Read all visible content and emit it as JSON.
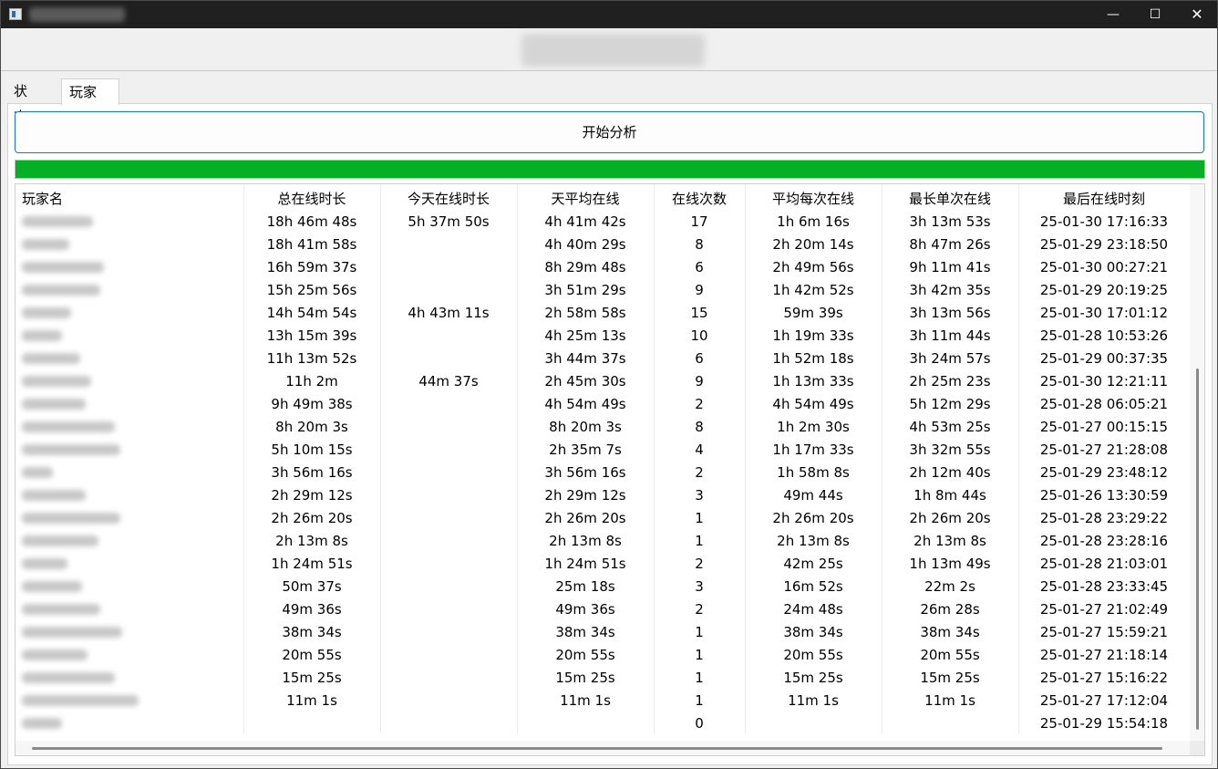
{
  "window": {
    "minimize_glyph": "—",
    "maximize_glyph": "☐",
    "close_glyph": "✕"
  },
  "tabs": [
    {
      "label": "状态",
      "selected": false
    },
    {
      "label": "玩家",
      "selected": true
    }
  ],
  "analyze_button": {
    "label": "开始分析"
  },
  "progress": {
    "percent": 100,
    "color": "#06b025"
  },
  "table": {
    "columns": [
      "玩家名",
      "总在线时长",
      "今天在线时长",
      "天平均在线",
      "在线次数",
      "平均每次在线",
      "最长单次在线",
      "最后在线时刻"
    ],
    "rows": [
      [
        "",
        "18h 46m 48s",
        "5h 37m 50s",
        "4h 41m 42s",
        "17",
        "1h 6m 16s",
        "3h 13m 53s",
        "25-01-30 17:16:33"
      ],
      [
        "",
        "18h 41m 58s",
        "",
        "4h 40m 29s",
        "8",
        "2h 20m 14s",
        "8h 47m 26s",
        "25-01-29 23:18:50"
      ],
      [
        "",
        "16h 59m 37s",
        "",
        "8h 29m 48s",
        "6",
        "2h 49m 56s",
        "9h 11m 41s",
        "25-01-30 00:27:21"
      ],
      [
        "",
        "15h 25m 56s",
        "",
        "3h 51m 29s",
        "9",
        "1h 42m 52s",
        "3h 42m 35s",
        "25-01-29 20:19:25"
      ],
      [
        "",
        "14h 54m 54s",
        "4h 43m 11s",
        "2h 58m 58s",
        "15",
        "59m 39s",
        "3h 13m 56s",
        "25-01-30 17:01:12"
      ],
      [
        "",
        "13h 15m 39s",
        "",
        "4h 25m 13s",
        "10",
        "1h 19m 33s",
        "3h 11m 44s",
        "25-01-28 10:53:26"
      ],
      [
        "",
        "11h 13m 52s",
        "",
        "3h 44m 37s",
        "6",
        "1h 52m 18s",
        "3h 24m 57s",
        "25-01-29 00:37:35"
      ],
      [
        "",
        "11h 2m",
        "44m 37s",
        "2h 45m 30s",
        "9",
        "1h 13m 33s",
        "2h 25m 23s",
        "25-01-30 12:21:11"
      ],
      [
        "",
        "9h 49m 38s",
        "",
        "4h 54m 49s",
        "2",
        "4h 54m 49s",
        "5h 12m 29s",
        "25-01-28 06:05:21"
      ],
      [
        "",
        "8h 20m 3s",
        "",
        "8h 20m 3s",
        "8",
        "1h 2m 30s",
        "4h 53m 25s",
        "25-01-27 00:15:15"
      ],
      [
        "",
        "5h 10m 15s",
        "",
        "2h 35m 7s",
        "4",
        "1h 17m 33s",
        "3h 32m 55s",
        "25-01-27 21:28:08"
      ],
      [
        "",
        "3h 56m 16s",
        "",
        "3h 56m 16s",
        "2",
        "1h 58m 8s",
        "2h 12m 40s",
        "25-01-29 23:48:12"
      ],
      [
        "",
        "2h 29m 12s",
        "",
        "2h 29m 12s",
        "3",
        "49m 44s",
        "1h 8m 44s",
        "25-01-26 13:30:59"
      ],
      [
        "",
        "2h 26m 20s",
        "",
        "2h 26m 20s",
        "1",
        "2h 26m 20s",
        "2h 26m 20s",
        "25-01-28 23:29:22"
      ],
      [
        "",
        "2h 13m 8s",
        "",
        "2h 13m 8s",
        "1",
        "2h 13m 8s",
        "2h 13m 8s",
        "25-01-28 23:28:16"
      ],
      [
        "",
        "1h 24m 51s",
        "",
        "1h 24m 51s",
        "2",
        "42m 25s",
        "1h 13m 49s",
        "25-01-28 21:03:01"
      ],
      [
        "",
        "50m 37s",
        "",
        "25m 18s",
        "3",
        "16m 52s",
        "22m 2s",
        "25-01-28 23:33:45"
      ],
      [
        "",
        "49m 36s",
        "",
        "49m 36s",
        "2",
        "24m 48s",
        "26m 28s",
        "25-01-27 21:02:49"
      ],
      [
        "",
        "38m 34s",
        "",
        "38m 34s",
        "1",
        "38m 34s",
        "38m 34s",
        "25-01-27 15:59:21"
      ],
      [
        "",
        "20m 55s",
        "",
        "20m 55s",
        "1",
        "20m 55s",
        "20m 55s",
        "25-01-27 21:18:14"
      ],
      [
        "",
        "15m 25s",
        "",
        "15m 25s",
        "1",
        "15m 25s",
        "15m 25s",
        "25-01-27 15:16:22"
      ],
      [
        "",
        "11m 1s",
        "",
        "11m 1s",
        "1",
        "11m 1s",
        "11m 1s",
        "25-01-27 17:12:04"
      ],
      [
        "",
        "",
        "",
        "",
        "0",
        "",
        "",
        "25-01-29 15:54:18"
      ]
    ]
  }
}
